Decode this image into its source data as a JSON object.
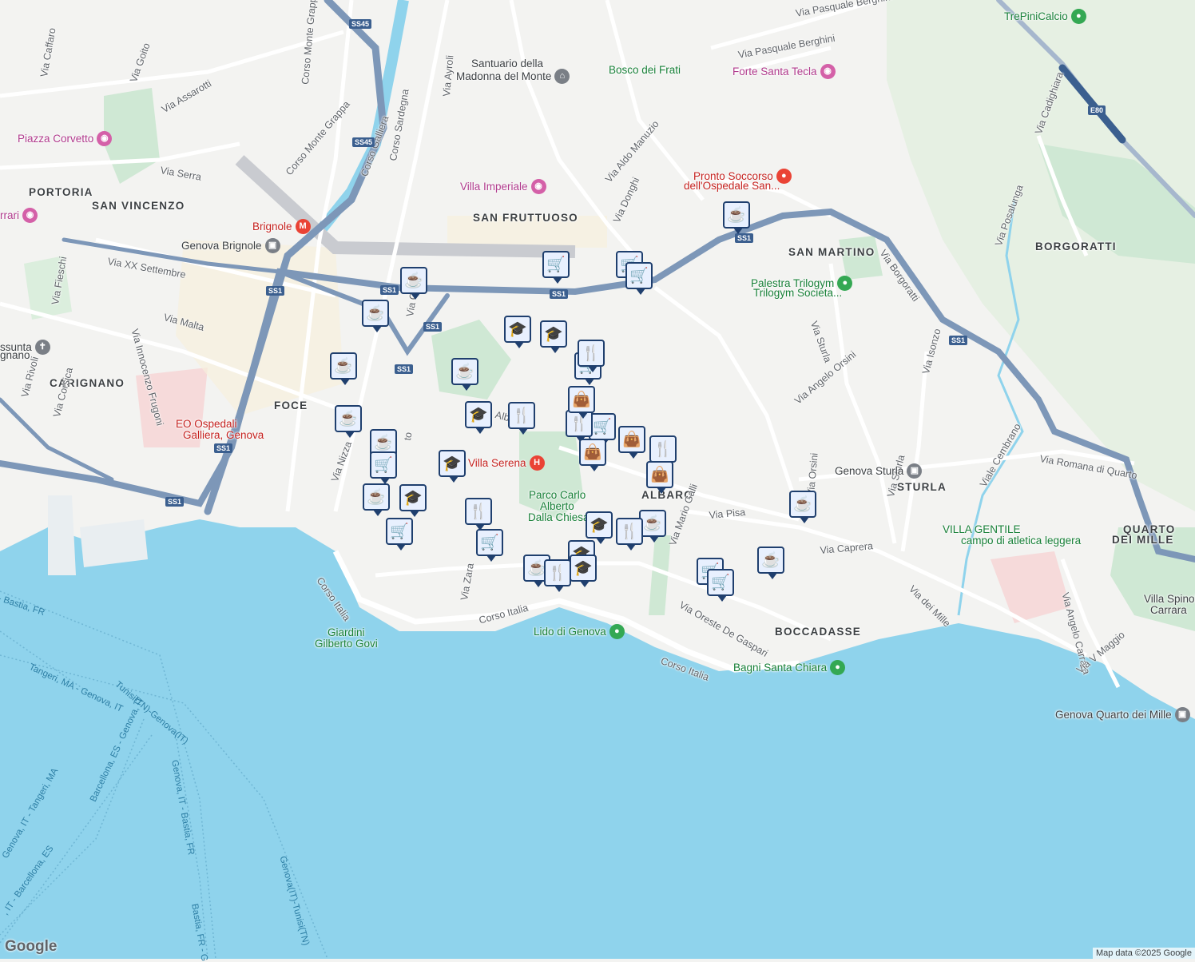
{
  "areas": [
    {
      "id": "portoria",
      "text": "PORTORIA"
    },
    {
      "id": "san-vincenzo",
      "text": "SAN VINCENZO"
    },
    {
      "id": "carignano",
      "text": "CARIGNANO"
    },
    {
      "id": "foce",
      "text": "FOCE"
    },
    {
      "id": "san-fruttuoso",
      "text": "SAN FRUTTUOSO"
    },
    {
      "id": "san-martino",
      "text": "SAN MARTINO"
    },
    {
      "id": "borgoratti",
      "text": "BORGORATTI"
    },
    {
      "id": "albaro",
      "text": "ALBARO"
    },
    {
      "id": "sturla",
      "text": "STURLA"
    },
    {
      "id": "boccadasse",
      "text": "BOCCADASSE"
    },
    {
      "id": "quarto-1",
      "text": "QUARTO"
    },
    {
      "id": "quarto-2",
      "text": "DEI MILLE"
    }
  ],
  "streets": [
    {
      "id": "via-caffaro",
      "text": "Via Caffaro"
    },
    {
      "id": "via-goito",
      "text": "Via Goito"
    },
    {
      "id": "via-assarotti",
      "text": "Via Assarotti"
    },
    {
      "id": "corso-monte-grappa-1",
      "text": "Corso Monte Grappa"
    },
    {
      "id": "corso-monte-grappa-2",
      "text": "Corso Monte Grappa"
    },
    {
      "id": "via-serra",
      "text": "Via Serra"
    },
    {
      "id": "corso-galliera",
      "text": "Corso Galliera"
    },
    {
      "id": "corso-sardegna",
      "text": "Corso Sardegna"
    },
    {
      "id": "via-ayroli",
      "text": "Via Ayroli"
    },
    {
      "id": "via-xx-settembre",
      "text": "Via XX Settembre"
    },
    {
      "id": "via-fieschi",
      "text": "Via Fieschi"
    },
    {
      "id": "via-innocenzo-frugoni",
      "text": "Via Innocenzo Frugoni"
    },
    {
      "id": "via-malta",
      "text": "Via Malta"
    },
    {
      "id": "via-rivoli",
      "text": "Via Rivoli"
    },
    {
      "id": "via-corsica",
      "text": "Via Corsica"
    },
    {
      "id": "via-nizza",
      "text": "Via Nizza"
    },
    {
      "id": "via-caffa",
      "text": "Via Caffa"
    },
    {
      "id": "via-to",
      "text": "to"
    },
    {
      "id": "via-alb",
      "text": "Alb"
    },
    {
      "id": "via-zara",
      "text": "Via Zara"
    },
    {
      "id": "corso-italia-1",
      "text": "Corso Italia"
    },
    {
      "id": "corso-italia-2",
      "text": "Corso Italia"
    },
    {
      "id": "corso-italia-3",
      "text": "Corso Italia"
    },
    {
      "id": "via-aldo-manuzio",
      "text": "Via Aldo Manuzio"
    },
    {
      "id": "via-donghi",
      "text": "Via Donghi"
    },
    {
      "id": "via-pasquale-berghini-1",
      "text": "Via Pasquale Berghini"
    },
    {
      "id": "via-pasquale-berghini-2",
      "text": "Via Pasquale Berghini"
    },
    {
      "id": "via-borgoratti",
      "text": "Via Borgoratti"
    },
    {
      "id": "via-sturla",
      "text": "Via Sturla"
    },
    {
      "id": "via-angelo-orsini",
      "text": "Via Angelo Orsini"
    },
    {
      "id": "via-orsini",
      "text": "Via Orsini"
    },
    {
      "id": "via-isonzo",
      "text": "Via Isonzo"
    },
    {
      "id": "via-posalunga",
      "text": "Via Posalunga"
    },
    {
      "id": "via-cadighiara",
      "text": "Via Cadighiara"
    },
    {
      "id": "via-romana-di-quarto",
      "text": "Via Romana di Quarto"
    },
    {
      "id": "viale-cembrano",
      "text": "Viale Cembrano"
    },
    {
      "id": "via-sturla-2",
      "text": "Via Sturla"
    },
    {
      "id": "via-pisa",
      "text": "Via Pisa"
    },
    {
      "id": "via-mario-galli",
      "text": "Via Mario Galli"
    },
    {
      "id": "via-caprera",
      "text": "Via Caprera"
    },
    {
      "id": "via-dei-mille",
      "text": "Via dei Mille"
    },
    {
      "id": "via-oreste-de-gaspari",
      "text": "Via Oreste De Gaspari"
    },
    {
      "id": "via-angelo-carrara",
      "text": "Via Angelo Carrara"
    },
    {
      "id": "via-v-maggio",
      "text": "Via V Maggio"
    }
  ],
  "ferries": [
    {
      "id": "f1",
      "text": "- Bastia, FR"
    },
    {
      "id": "f2",
      "text": "Tangeri, MA - Genova, IT"
    },
    {
      "id": "f3",
      "text": "Tunisi(TN)-Genova(IT)"
    },
    {
      "id": "f4",
      "text": "Genova, IT - Bastia, FR"
    },
    {
      "id": "f5",
      "text": "Barcellona, ES - Genova, IT"
    },
    {
      "id": "f6",
      "text": "Genova, IT - Tangeri, MA"
    },
    {
      "id": "f7",
      "text": "Genova(IT)-Tunisi(TN)"
    },
    {
      "id": "f8",
      "text": "Bastia, FR - G"
    },
    {
      "id": "f9",
      "text": ", IT - Barcellona, ES"
    }
  ],
  "pois": [
    {
      "id": "piazza-corvetto",
      "text": "Piazza Corvetto",
      "icon": "camera-icon",
      "glyph": "◉"
    },
    {
      "id": "rrari",
      "text": "rrari",
      "icon": "camera-icon",
      "glyph": "◉"
    },
    {
      "id": "brignole",
      "text": "Brignole",
      "icon": "metro-icon",
      "glyph": "M"
    },
    {
      "id": "genova-brignole",
      "text": "Genova Brignole",
      "icon": "train-icon",
      "glyph": "▣"
    },
    {
      "id": "santuario-1",
      "text": "Santuario della",
      "icon": "",
      "glyph": ""
    },
    {
      "id": "santuario-2",
      "text": "Madonna del Monte",
      "icon": "museum-icon",
      "glyph": "⌂"
    },
    {
      "id": "bosco-dei-frati",
      "text": "Bosco dei Frati",
      "icon": "tree-icon",
      "glyph": "▲"
    },
    {
      "id": "forte-santa-tecla",
      "text": "Forte Santa Tecla",
      "icon": "camera-icon",
      "glyph": "◉"
    },
    {
      "id": "trepinicalcio",
      "text": "TrePiniCalcio",
      "icon": "sport-icon",
      "glyph": "●"
    },
    {
      "id": "villa-imperiale",
      "text": "Villa Imperiale",
      "icon": "camera-icon",
      "glyph": "◉"
    },
    {
      "id": "pronto-soccorso-1",
      "text": "Pronto Soccorso",
      "icon": "pin-icon",
      "glyph": "●"
    },
    {
      "id": "pronto-soccorso-2",
      "text": "dell'Ospedale San...",
      "icon": "",
      "glyph": ""
    },
    {
      "id": "palestra-1",
      "text": "Palestra Trilogym",
      "icon": "gym-icon",
      "glyph": "●"
    },
    {
      "id": "palestra-2",
      "text": "Trilogym Societa...",
      "icon": "",
      "glyph": ""
    },
    {
      "id": "assunta-1",
      "text": "ssunta",
      "icon": "church-icon",
      "glyph": "✝"
    },
    {
      "id": "assunta-2",
      "text": "gnano",
      "icon": "",
      "glyph": ""
    },
    {
      "id": "galliera-1",
      "text": "EO Ospedali",
      "icon": "hospital-icon",
      "glyph": "H"
    },
    {
      "id": "galliera-2",
      "text": "Galliera, Genova",
      "icon": "",
      "glyph": ""
    },
    {
      "id": "villa-serena",
      "text": "Villa Serena",
      "icon": "hospital-icon",
      "glyph": "H"
    },
    {
      "id": "parco-1",
      "text": "Parco Carlo",
      "icon": "",
      "glyph": ""
    },
    {
      "id": "parco-2",
      "text": "Alberto",
      "icon": "",
      "glyph": ""
    },
    {
      "id": "parco-3",
      "text": "Dalla Chiesa",
      "icon": "",
      "glyph": ""
    },
    {
      "id": "genova-sturla",
      "text": "Genova Sturla",
      "icon": "train-icon",
      "glyph": "▣"
    },
    {
      "id": "villa-gentile-1",
      "text": "VILLA GENTILE",
      "icon": "sport-icon",
      "glyph": "●"
    },
    {
      "id": "villa-gentile-2",
      "text": "campo di atletica leggera",
      "icon": "",
      "glyph": ""
    },
    {
      "id": "villa-spinola-1",
      "text": "Villa Spinol",
      "icon": "",
      "glyph": ""
    },
    {
      "id": "villa-spinola-2",
      "text": "Carrara",
      "icon": "",
      "glyph": ""
    },
    {
      "id": "giardini-1",
      "text": "Giardini",
      "icon": "",
      "glyph": ""
    },
    {
      "id": "giardini-2",
      "text": "Gilberto Govi",
      "icon": "",
      "glyph": ""
    },
    {
      "id": "lido",
      "text": "Lido di Genova",
      "icon": "pin-icon",
      "glyph": "●"
    },
    {
      "id": "bagni",
      "text": "Bagni Santa Chiara",
      "icon": "pin-icon",
      "glyph": "●"
    },
    {
      "id": "quarto-station",
      "text": "Genova Quarto dei Mille",
      "icon": "train-icon",
      "glyph": "▣"
    }
  ],
  "shields": [
    {
      "id": "s1",
      "text": "SS45"
    },
    {
      "id": "s2",
      "text": "SS45"
    },
    {
      "id": "s3",
      "text": "SS1"
    },
    {
      "id": "s4",
      "text": "SS1"
    },
    {
      "id": "s5",
      "text": "SS1"
    },
    {
      "id": "s6",
      "text": "SS1"
    },
    {
      "id": "s7",
      "text": "SS1"
    },
    {
      "id": "s8",
      "text": "SS1"
    },
    {
      "id": "s9",
      "text": "SS1"
    },
    {
      "id": "s10",
      "text": "SS1"
    },
    {
      "id": "s11",
      "text": "SS1"
    },
    {
      "id": "s12",
      "text": "E80"
    }
  ],
  "markers": [
    {
      "type": "cafe",
      "icon": "coffee-cup-icon"
    },
    {
      "type": "cafe",
      "icon": "coffee-cup-icon"
    },
    {
      "type": "cafe",
      "icon": "coffee-cup-icon"
    },
    {
      "type": "cafe",
      "icon": "coffee-cup-icon"
    },
    {
      "type": "cafe",
      "icon": "coffee-cup-icon"
    },
    {
      "type": "cafe",
      "icon": "coffee-cup-icon"
    },
    {
      "type": "cafe",
      "icon": "coffee-cup-icon"
    },
    {
      "type": "cafe",
      "icon": "coffee-cup-icon"
    },
    {
      "type": "cafe",
      "icon": "coffee-cup-icon"
    },
    {
      "type": "cafe",
      "icon": "coffee-cup-icon"
    },
    {
      "type": "cafe",
      "icon": "coffee-cup-icon"
    },
    {
      "type": "cafe",
      "icon": "coffee-cup-icon"
    },
    {
      "type": "shopping",
      "icon": "shopping-cart-icon"
    },
    {
      "type": "shopping",
      "icon": "shopping-cart-icon"
    },
    {
      "type": "shopping",
      "icon": "shopping-cart-icon"
    },
    {
      "type": "shopping",
      "icon": "shopping-cart-icon"
    },
    {
      "type": "shopping",
      "icon": "shopping-cart-icon"
    },
    {
      "type": "shopping",
      "icon": "shopping-cart-icon"
    },
    {
      "type": "shopping",
      "icon": "shopping-cart-icon"
    },
    {
      "type": "shopping",
      "icon": "shopping-cart-icon"
    },
    {
      "type": "shopping",
      "icon": "shopping-cart-icon"
    },
    {
      "type": "shopping",
      "icon": "shopping-cart-icon"
    },
    {
      "type": "school",
      "icon": "graduation-cap-icon"
    },
    {
      "type": "school",
      "icon": "graduation-cap-icon"
    },
    {
      "type": "school",
      "icon": "graduation-cap-icon"
    },
    {
      "type": "school",
      "icon": "graduation-cap-icon"
    },
    {
      "type": "school",
      "icon": "graduation-cap-icon"
    },
    {
      "type": "school",
      "icon": "graduation-cap-icon"
    },
    {
      "type": "school",
      "icon": "graduation-cap-icon"
    },
    {
      "type": "school",
      "icon": "graduation-cap-icon"
    },
    {
      "type": "restaurant",
      "icon": "fork-knife-icon"
    },
    {
      "type": "restaurant",
      "icon": "fork-knife-icon"
    },
    {
      "type": "restaurant",
      "icon": "fork-knife-icon"
    },
    {
      "type": "restaurant",
      "icon": "fork-knife-icon"
    },
    {
      "type": "restaurant",
      "icon": "fork-knife-icon"
    },
    {
      "type": "restaurant",
      "icon": "fork-knife-icon"
    },
    {
      "type": "restaurant",
      "icon": "fork-knife-icon"
    },
    {
      "type": "bag",
      "icon": "shopping-bag-icon"
    },
    {
      "type": "bag",
      "icon": "shopping-bag-icon"
    },
    {
      "type": "bag",
      "icon": "shopping-bag-icon"
    },
    {
      "type": "bag",
      "icon": "shopping-bag-icon"
    }
  ],
  "glyphs": {
    "cafe": "☕",
    "shopping": "🛒",
    "school": "🎓",
    "restaurant": "🍴",
    "bag": "👜"
  },
  "colors": {
    "sea": "#8fd3ec",
    "land": "#f3f3f1",
    "park": "#cfe8d4",
    "highway": "#7d97b8",
    "road": "#ffffff",
    "pin_border": "#1f3f6e"
  },
  "brand": "Google",
  "attribution": "Map data ©2025 Google"
}
